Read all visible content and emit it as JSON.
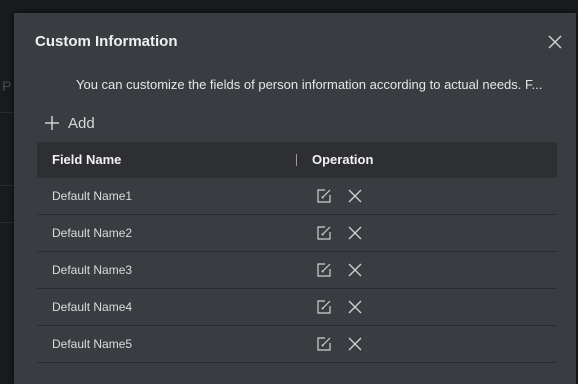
{
  "background": {
    "partial_letter": "P"
  },
  "dialog": {
    "title": "Custom Information",
    "close_icon": "close-icon",
    "description": "You can customize the fields of person information according to actual needs. F...",
    "add_label": "Add",
    "add_icon": "plus-icon"
  },
  "table": {
    "columns": [
      "Field Name",
      "Operation"
    ],
    "rows": [
      {
        "name": "Default Name1"
      },
      {
        "name": "Default Name2"
      },
      {
        "name": "Default Name3"
      },
      {
        "name": "Default Name4"
      },
      {
        "name": "Default Name5"
      }
    ],
    "row_actions": [
      "edit-icon",
      "delete-icon"
    ]
  },
  "colors": {
    "dialog_bg": "#393c41",
    "header_bg": "#2d2f33",
    "text": "#dcdcdc"
  }
}
